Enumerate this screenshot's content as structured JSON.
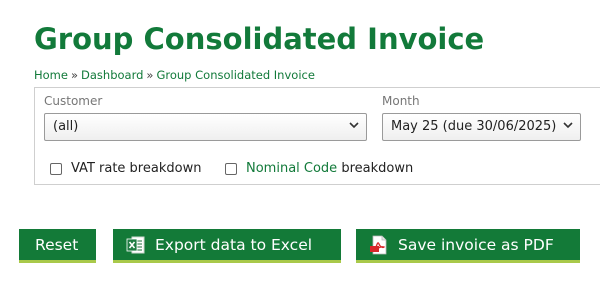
{
  "header": {
    "title": "Group Consolidated Invoice"
  },
  "breadcrumb": {
    "items": [
      "Home",
      "Dashboard",
      "Group Consolidated Invoice"
    ],
    "separator": "»"
  },
  "filters": {
    "customer": {
      "label": "Customer",
      "value": "(all)"
    },
    "month": {
      "label": "Month",
      "value": "May 25 (due 30/06/2025)"
    },
    "vat_breakdown": {
      "label": "VAT rate breakdown",
      "checked": false
    },
    "nominal_breakdown": {
      "label_link": "Nominal Code",
      "label_rest": " breakdown",
      "checked": false
    }
  },
  "buttons": {
    "reset": "Reset",
    "export_excel": "Export data to Excel",
    "save_pdf": "Save invoice as PDF"
  },
  "icons": {
    "excel": "excel-icon",
    "pdf": "pdf-icon",
    "dropdown": "chevron-down-icon"
  },
  "colors": {
    "brand_green": "#137a38",
    "accent_underline": "#a9c94a"
  }
}
